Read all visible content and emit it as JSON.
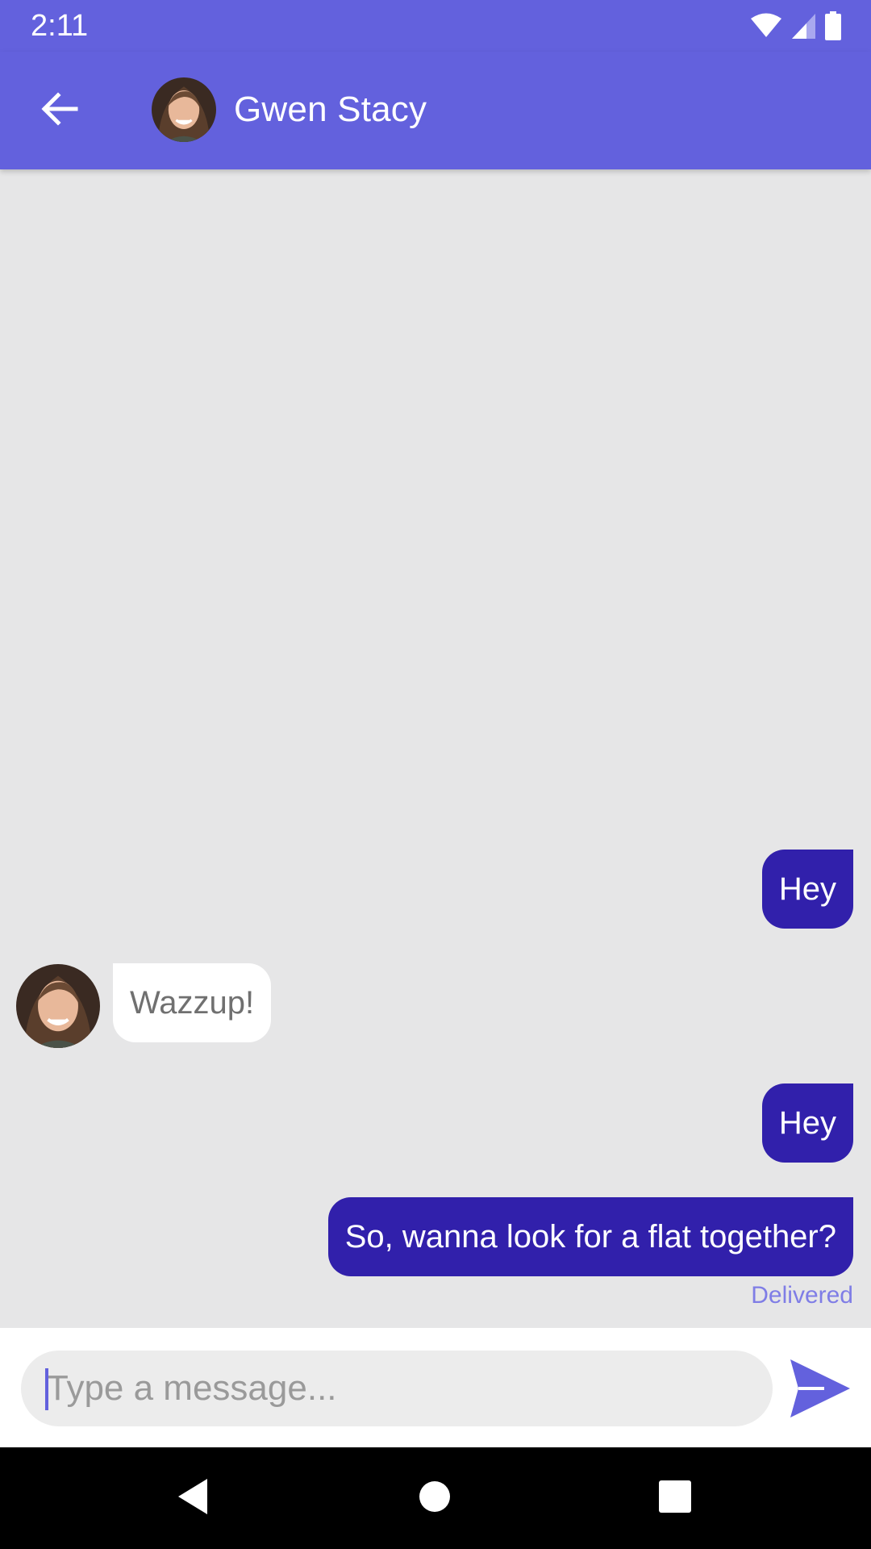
{
  "status_bar": {
    "time": "2:11",
    "icons": [
      "wifi-icon",
      "cell-signal-icon",
      "battery-icon"
    ]
  },
  "header": {
    "back_icon": "arrow-left-icon",
    "contact_name": "Gwen Stacy",
    "avatar": "contact-avatar"
  },
  "messages": [
    {
      "direction": "out",
      "text": "Hey"
    },
    {
      "direction": "in",
      "text": "Wazzup!",
      "avatar": "contact-avatar"
    },
    {
      "direction": "out",
      "text": "Hey"
    },
    {
      "direction": "out",
      "text": "So, wanna look for a flat together?",
      "status": "Delivered"
    }
  ],
  "composer": {
    "placeholder": "Type a message...",
    "value": "",
    "send_icon": "send-icon"
  },
  "nav_bar": {
    "icons": [
      "nav-back-icon",
      "nav-home-icon",
      "nav-recents-icon"
    ]
  },
  "colors": {
    "primary": "#6361dd",
    "outgoing_bubble": "#3120ab",
    "incoming_bubble": "#ffffff",
    "chat_background": "#e6e6e7",
    "delivered_text": "#7f7de6"
  }
}
